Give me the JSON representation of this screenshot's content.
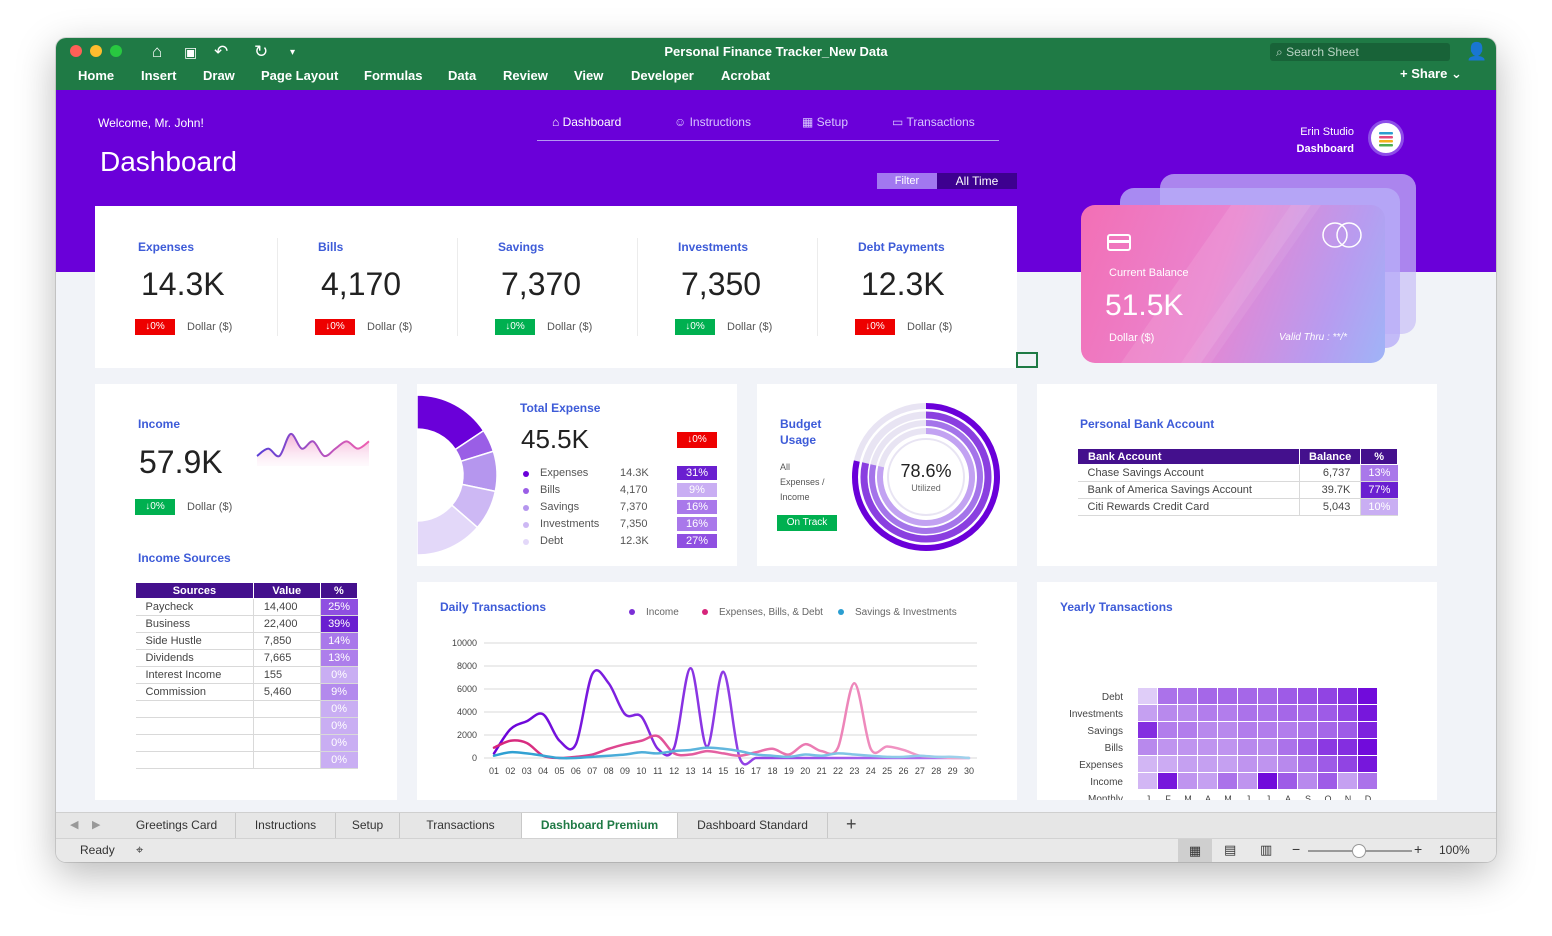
{
  "app": {
    "title": "Personal Finance Tracker_New Data",
    "search_placeholder": "Search Sheet",
    "share_label": "Share",
    "menu": [
      "Home",
      "Insert",
      "Draw",
      "Page Layout",
      "Formulas",
      "Data",
      "Review",
      "View",
      "Developer",
      "Acrobat"
    ]
  },
  "header": {
    "welcome": "Welcome, Mr. John!",
    "title": "Dashboard",
    "nav": [
      "Dashboard",
      "Instructions",
      "Setup",
      "Transactions"
    ],
    "studio_name": "Erin Studio",
    "studio_sub": "Dashboard",
    "filter_label": "Filter",
    "filter_value": "All Time"
  },
  "kpis": [
    {
      "label": "Expenses",
      "value": "14.3K",
      "change": "↓0%",
      "status": "red",
      "unit": "Dollar ($)"
    },
    {
      "label": "Bills",
      "value": "4,170",
      "change": "↓0%",
      "status": "red",
      "unit": "Dollar ($)"
    },
    {
      "label": "Savings",
      "value": "7,370",
      "change": "↓0%",
      "status": "green",
      "unit": "Dollar ($)"
    },
    {
      "label": "Investments",
      "value": "7,350",
      "change": "↓0%",
      "status": "green",
      "unit": "Dollar ($)"
    },
    {
      "label": "Debt Payments",
      "value": "12.3K",
      "change": "↓0%",
      "status": "red",
      "unit": "Dollar ($)"
    }
  ],
  "balance_card": {
    "label": "Current Balance",
    "value": "51.5K",
    "unit": "Dollar ($)",
    "valid": "Valid Thru : **/*"
  },
  "income": {
    "label": "Income",
    "value": "57.9K",
    "change": "↓0%",
    "unit": "Dollar ($)",
    "sparkline": [
      6,
      7,
      6,
      9,
      7,
      8,
      6,
      7,
      8,
      7,
      8
    ]
  },
  "income_sources": {
    "title": "Income Sources",
    "headers": [
      "Sources",
      "Value",
      "%"
    ],
    "rows": [
      [
        "Paycheck",
        "14,400",
        "25%"
      ],
      [
        "Business",
        "22,400",
        "39%"
      ],
      [
        "Side Hustle",
        "7,850",
        "14%"
      ],
      [
        "Dividends",
        "7,665",
        "13%"
      ],
      [
        "Interest Income",
        "155",
        "0%"
      ],
      [
        "Commission",
        "5,460",
        "9%"
      ],
      [
        "",
        "",
        "0%"
      ],
      [
        "",
        "",
        "0%"
      ],
      [
        "",
        "",
        "0%"
      ],
      [
        "",
        "",
        "0%"
      ]
    ]
  },
  "total_expense": {
    "title": "Total Expense",
    "value": "45.5K",
    "change": "↓0%",
    "items": [
      {
        "name": "Expenses",
        "value": "14.3K",
        "pct": "31%",
        "color": "#6a00d9"
      },
      {
        "name": "Bills",
        "value": "4,170",
        "pct": "9%",
        "color": "#9a5ee6"
      },
      {
        "name": "Savings",
        "value": "7,370",
        "pct": "16%",
        "color": "#b596ee"
      },
      {
        "name": "Investments",
        "value": "7,350",
        "pct": "16%",
        "color": "#cdb8f4"
      },
      {
        "name": "Debt",
        "value": "12.3K",
        "pct": "27%",
        "color": "#e3d8f9"
      }
    ]
  },
  "budget": {
    "title_line1": "Budget",
    "title_line2": "Usage",
    "desc": [
      "All",
      "Expenses /",
      "Income"
    ],
    "status": "On Track",
    "pct": "78.6%",
    "pct_value": 78.6,
    "utilized": "Utilized"
  },
  "bank": {
    "title": "Personal Bank Account",
    "headers": [
      "Bank Account",
      "Balance",
      "%"
    ],
    "rows": [
      [
        "Chase Savings Account",
        "6,737",
        "13%"
      ],
      [
        "Bank of America Savings Account",
        "39.7K",
        "77%"
      ],
      [
        "Citi Rewards Credit Card",
        "5,043",
        "10%"
      ]
    ]
  },
  "chart_data": [
    {
      "type": "line",
      "title": "Daily Transactions",
      "x": [
        "01",
        "02",
        "03",
        "04",
        "05",
        "06",
        "07",
        "08",
        "09",
        "10",
        "11",
        "12",
        "13",
        "14",
        "15",
        "16",
        "17",
        "18",
        "19",
        "20",
        "21",
        "22",
        "23",
        "24",
        "25",
        "26",
        "27",
        "28",
        "29",
        "30"
      ],
      "ylim": [
        0,
        10000
      ],
      "yticks": [
        "10000",
        "8000",
        "6000",
        "4000",
        "2000",
        "0"
      ],
      "series": [
        {
          "name": "Income",
          "color": "#7b2fd6",
          "values": [
            400,
            2500,
            3200,
            3800,
            1500,
            1200,
            7300,
            6500,
            3800,
            3600,
            800,
            900,
            7800,
            1000,
            7500,
            0,
            0,
            0,
            0,
            0,
            0,
            0,
            0,
            0,
            0,
            0,
            0,
            0,
            0,
            0
          ]
        },
        {
          "name": "Expenses, Bills, & Debt",
          "color": "#d6247a",
          "values": [
            900,
            1500,
            1300,
            200,
            0,
            100,
            300,
            800,
            1200,
            1500,
            1900,
            400,
            300,
            600,
            400,
            200,
            500,
            800,
            300,
            1200,
            600,
            900,
            6500,
            800,
            1000,
            700,
            200,
            100,
            0,
            0
          ]
        },
        {
          "name": "Savings & Investments",
          "color": "#2b9ed1",
          "values": [
            200,
            500,
            400,
            200,
            0,
            0,
            100,
            200,
            300,
            500,
            400,
            600,
            700,
            900,
            800,
            600,
            300,
            200,
            100,
            300,
            200,
            400,
            300,
            200,
            100,
            100,
            200,
            100,
            100,
            0
          ]
        }
      ]
    },
    {
      "type": "heatmap",
      "title": "Yearly Transactions",
      "rows": [
        "Debt",
        "Investments",
        "Savings",
        "Bills",
        "Expenses",
        "Income"
      ],
      "footer_label": "Monthly",
      "columns": [
        "J",
        "F",
        "M",
        "A",
        "M",
        "J",
        "J",
        "A",
        "S",
        "O",
        "N",
        "D"
      ],
      "values": [
        [
          0.1,
          0.5,
          0.5,
          0.55,
          0.55,
          0.55,
          0.55,
          0.6,
          0.65,
          0.7,
          0.8,
          0.95
        ],
        [
          0.3,
          0.4,
          0.4,
          0.45,
          0.45,
          0.5,
          0.5,
          0.55,
          0.55,
          0.6,
          0.7,
          0.9
        ],
        [
          0.8,
          0.45,
          0.45,
          0.4,
          0.4,
          0.45,
          0.45,
          0.45,
          0.5,
          0.55,
          0.6,
          0.85
        ],
        [
          0.4,
          0.35,
          0.35,
          0.35,
          0.35,
          0.4,
          0.4,
          0.5,
          0.6,
          0.75,
          0.8,
          0.95
        ],
        [
          0.2,
          0.25,
          0.3,
          0.3,
          0.3,
          0.35,
          0.35,
          0.4,
          0.5,
          0.6,
          0.7,
          0.9
        ],
        [
          0.2,
          0.9,
          0.35,
          0.3,
          0.5,
          0.35,
          0.95,
          0.6,
          0.4,
          0.6,
          0.3,
          0.5
        ]
      ]
    }
  ],
  "sheet_tabs": [
    "Greetings Card",
    "Instructions",
    "Setup",
    "Transactions",
    "Dashboard Premium",
    "Dashboard Standard"
  ],
  "status": {
    "ready": "Ready",
    "zoom": "100%"
  }
}
